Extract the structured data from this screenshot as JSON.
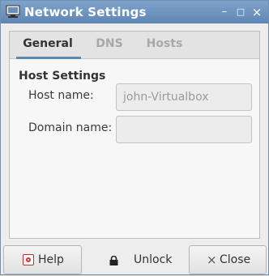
{
  "window": {
    "title": "Network Settings",
    "controls": {
      "minimize": "–",
      "maximize": "□",
      "close": "×"
    }
  },
  "tabs": [
    {
      "label": "General",
      "active": true
    },
    {
      "label": "DNS",
      "active": false
    },
    {
      "label": "Hosts",
      "active": false
    }
  ],
  "general": {
    "section_title": "Host Settings",
    "host_name_label": "Host name:",
    "host_name_value": "john-Virtualbox",
    "domain_name_label": "Domain name:",
    "domain_name_value": ""
  },
  "buttons": {
    "help": "Help",
    "unlock": "Unlock",
    "close": "Close"
  },
  "icons": {
    "app": "network-settings-icon",
    "help": "help-icon",
    "unlock": "lock-icon",
    "close": "close-icon"
  },
  "colors": {
    "titlebar": "#5f87b4",
    "accent": "#5f87b4",
    "inactive_tab": "#a8a8a8"
  }
}
